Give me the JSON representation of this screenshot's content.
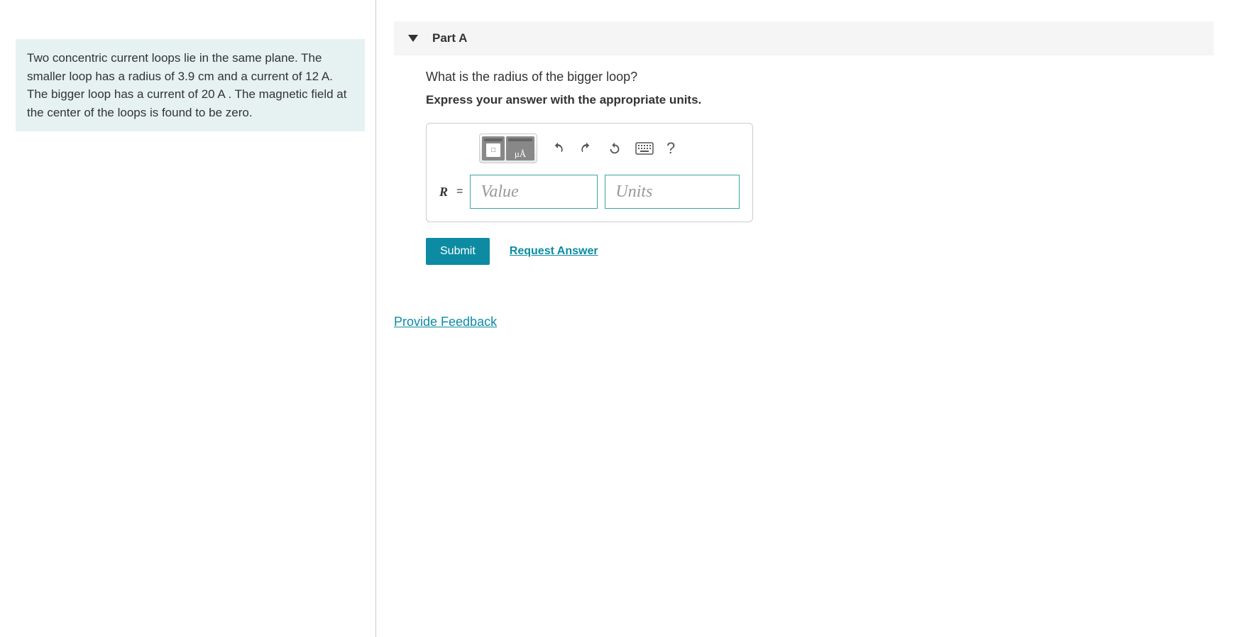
{
  "problem": "Two concentric current loops lie in the same plane. The smaller loop has a radius of 3.9  cm and a current of 12 A. The bigger loop has a current of 20 A . The magnetic field at the center of the loops is found to be zero.",
  "part": {
    "label": "Part A",
    "question": "What is the radius of the bigger loop?",
    "instruction": "Express your answer with the appropriate units.",
    "variable": "R",
    "equals": "=",
    "value_placeholder": "Value",
    "units_placeholder": "Units",
    "toolbar": {
      "templates_icon_text": "□",
      "symbols_icon_text": "μÅ"
    }
  },
  "actions": {
    "submit": "Submit",
    "request": "Request Answer"
  },
  "feedback": "Provide Feedback",
  "help_glyph": "?"
}
